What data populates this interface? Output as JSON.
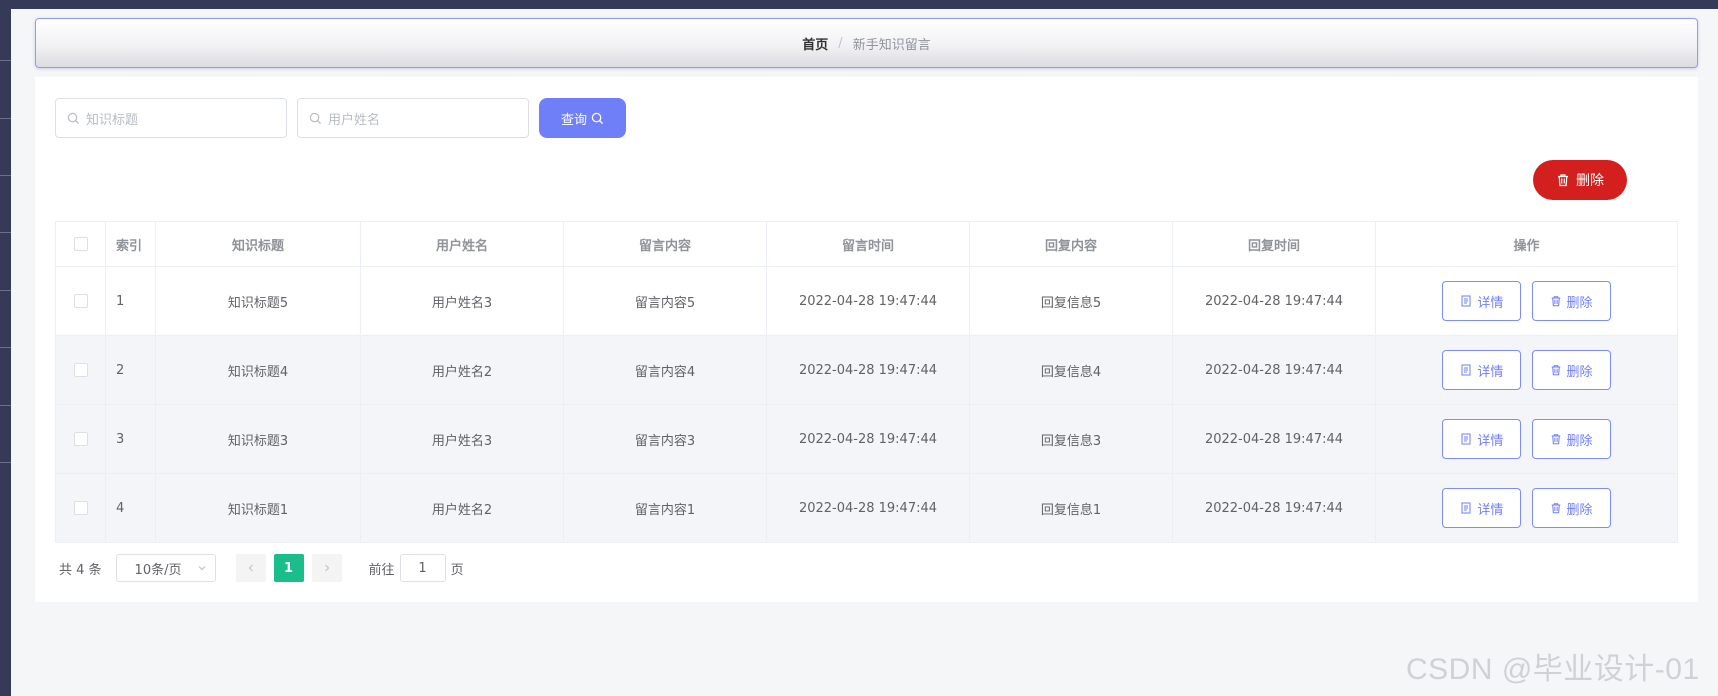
{
  "breadcrumb": {
    "home": "首页",
    "separator": "/",
    "current": "新手知识留言"
  },
  "search": {
    "title_placeholder": "知识标题",
    "user_placeholder": "用户姓名",
    "query_label": "查询"
  },
  "toolbar": {
    "delete_label": "删除"
  },
  "table": {
    "headers": [
      "索引",
      "知识标题",
      "用户姓名",
      "留言内容",
      "留言时间",
      "回复内容",
      "回复时间",
      "操作"
    ],
    "rows": [
      {
        "index": "1",
        "title": "知识标题5",
        "user": "用户姓名3",
        "content": "留言内容5",
        "time": "2022-04-28 19:47:44",
        "reply": "回复信息5",
        "reply_time": "2022-04-28 19:47:44"
      },
      {
        "index": "2",
        "title": "知识标题4",
        "user": "用户姓名2",
        "content": "留言内容4",
        "time": "2022-04-28 19:47:44",
        "reply": "回复信息4",
        "reply_time": "2022-04-28 19:47:44"
      },
      {
        "index": "3",
        "title": "知识标题3",
        "user": "用户姓名3",
        "content": "留言内容3",
        "time": "2022-04-28 19:47:44",
        "reply": "回复信息3",
        "reply_time": "2022-04-28 19:47:44"
      },
      {
        "index": "4",
        "title": "知识标题1",
        "user": "用户姓名2",
        "content": "留言内容1",
        "time": "2022-04-28 19:47:44",
        "reply": "回复信息1",
        "reply_time": "2022-04-28 19:47:44"
      }
    ],
    "detail_label": "详情",
    "delete_label": "删除"
  },
  "pagination": {
    "total_text": "共 4 条",
    "page_size": "10条/页",
    "current_page": "1",
    "goto_prefix": "前往",
    "goto_value": "1",
    "goto_suffix": "页"
  },
  "watermark": "CSDN @毕业设计-01",
  "colors": {
    "accent": "#6f7ff7",
    "danger": "#d3201f",
    "active_page": "#19be8a",
    "sidebar": "#353a58"
  }
}
